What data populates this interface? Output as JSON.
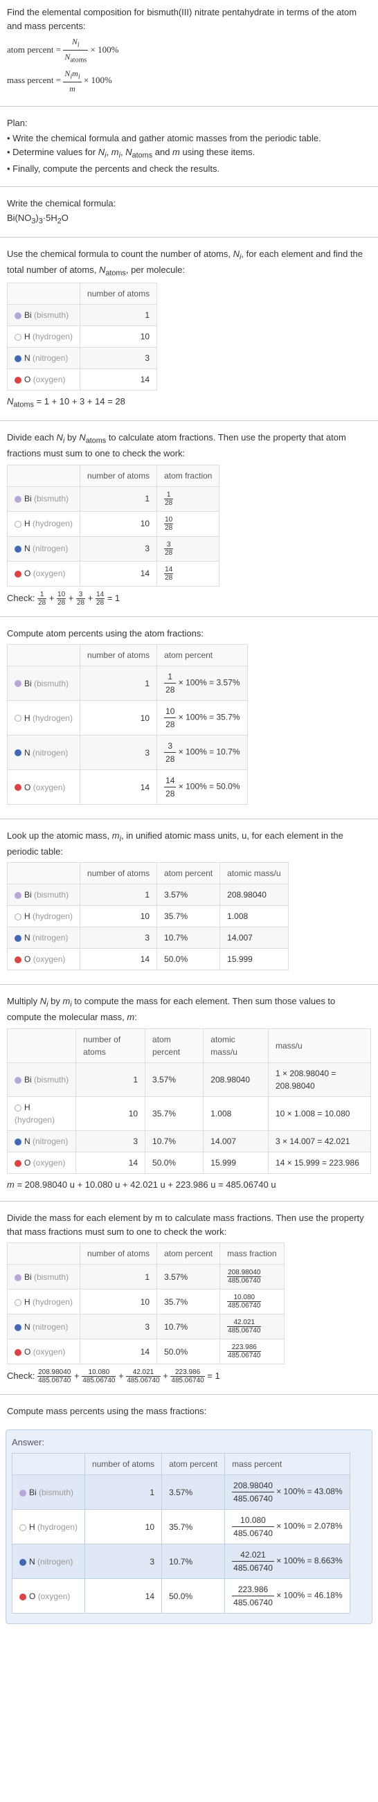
{
  "intro": {
    "line1": "Find the elemental composition for bismuth(III) nitrate pentahydrate in terms of the atom and mass percents:",
    "atom_percent_label": "atom percent",
    "mass_percent_label": "mass percent",
    "eq": "=",
    "times100": "× 100%",
    "Ni": "N",
    "i": "i",
    "Natoms": "N",
    "atoms": "atoms",
    "mi_N": "N",
    "mi_i": "i",
    "mi_m_i": "m",
    "mi_m": "m"
  },
  "plan": {
    "title": "Plan:",
    "items": [
      "• Write the chemical formula and gather atomic masses from the periodic table.",
      "• Determine values for Nᵢ, mᵢ, N_atoms and m using these items.",
      "• Finally, compute the percents and check the results."
    ]
  },
  "formula_section": {
    "title": "Write the chemical formula:",
    "formula_pre": "Bi(NO",
    "s3": "3",
    "close": ")",
    "s3b": "3",
    "dot": "·5H",
    "s2": "2",
    "O": "O"
  },
  "count_section": {
    "text": "Use the chemical formula to count the number of atoms, Nᵢ, for each element and find the total number of atoms, N_atoms, per molecule:",
    "headers": [
      "",
      "number of atoms"
    ],
    "rows": [
      {
        "el": "Bi",
        "name": "(bismuth)",
        "n": "1"
      },
      {
        "el": "H",
        "name": "(hydrogen)",
        "n": "10"
      },
      {
        "el": "N",
        "name": "(nitrogen)",
        "n": "3"
      },
      {
        "el": "O",
        "name": "(oxygen)",
        "n": "14"
      }
    ],
    "total_line": "N_atoms = 1 + 10 + 3 + 14 = 28"
  },
  "atomfrac_section": {
    "text": "Divide each Nᵢ by N_atoms to calculate atom fractions. Then use the property that atom fractions must sum to one to check the work:",
    "headers": [
      "",
      "number of atoms",
      "atom fraction"
    ],
    "rows": [
      {
        "el": "Bi",
        "name": "(bismuth)",
        "n": "1",
        "fn": "1",
        "fd": "28"
      },
      {
        "el": "H",
        "name": "(hydrogen)",
        "n": "10",
        "fn": "10",
        "fd": "28"
      },
      {
        "el": "N",
        "name": "(nitrogen)",
        "n": "3",
        "fn": "3",
        "fd": "28"
      },
      {
        "el": "O",
        "name": "(oxygen)",
        "n": "14",
        "fn": "14",
        "fd": "28"
      }
    ],
    "check_label": "Check:",
    "check_expr": " = 1"
  },
  "atompct_section": {
    "text": "Compute atom percents using the atom fractions:",
    "headers": [
      "",
      "number of atoms",
      "atom percent"
    ],
    "rows": [
      {
        "el": "Bi",
        "name": "(bismuth)",
        "n": "1",
        "fn": "1",
        "fd": "28",
        "pct": " × 100% = 3.57%"
      },
      {
        "el": "H",
        "name": "(hydrogen)",
        "n": "10",
        "fn": "10",
        "fd": "28",
        "pct": " × 100% = 35.7%"
      },
      {
        "el": "N",
        "name": "(nitrogen)",
        "n": "3",
        "fn": "3",
        "fd": "28",
        "pct": " × 100% = 10.7%"
      },
      {
        "el": "O",
        "name": "(oxygen)",
        "n": "14",
        "fn": "14",
        "fd": "28",
        "pct": " × 100% = 50.0%"
      }
    ]
  },
  "atomicmass_section": {
    "text": "Look up the atomic mass, mᵢ, in unified atomic mass units, u, for each element in the periodic table:",
    "headers": [
      "",
      "number of atoms",
      "atom percent",
      "atomic mass/u"
    ],
    "rows": [
      {
        "el": "Bi",
        "name": "(bismuth)",
        "n": "1",
        "pct": "3.57%",
        "mass": "208.98040"
      },
      {
        "el": "H",
        "name": "(hydrogen)",
        "n": "10",
        "pct": "35.7%",
        "mass": "1.008"
      },
      {
        "el": "N",
        "name": "(nitrogen)",
        "n": "3",
        "pct": "10.7%",
        "mass": "14.007"
      },
      {
        "el": "O",
        "name": "(oxygen)",
        "n": "14",
        "pct": "50.0%",
        "mass": "15.999"
      }
    ]
  },
  "molarmass_section": {
    "text": "Multiply Nᵢ by mᵢ to compute the mass for each element. Then sum those values to compute the molecular mass, m:",
    "headers": [
      "",
      "number of atoms",
      "atom percent",
      "atomic mass/u",
      "mass/u"
    ],
    "rows": [
      {
        "el": "Bi",
        "name": "(bismuth)",
        "n": "1",
        "pct": "3.57%",
        "amass": "208.98040",
        "calc": "1 × 208.98040 = 208.98040"
      },
      {
        "el": "H",
        "name": "(hydrogen)",
        "n": "10",
        "pct": "35.7%",
        "amass": "1.008",
        "calc": "10 × 1.008 = 10.080"
      },
      {
        "el": "N",
        "name": "(nitrogen)",
        "n": "3",
        "pct": "10.7%",
        "amass": "14.007",
        "calc": "3 × 14.007 = 42.021"
      },
      {
        "el": "O",
        "name": "(oxygen)",
        "n": "14",
        "pct": "50.0%",
        "amass": "15.999",
        "calc": "14 × 15.999 = 223.986"
      }
    ],
    "total_line": "m = 208.98040 u + 10.080 u + 42.021 u + 223.986 u = 485.06740 u"
  },
  "massfrac_section": {
    "text": "Divide the mass for each element by m to calculate mass fractions. Then use the property that mass fractions must sum to one to check the work:",
    "headers": [
      "",
      "number of atoms",
      "atom percent",
      "mass fraction"
    ],
    "rows": [
      {
        "el": "Bi",
        "name": "(bismuth)",
        "n": "1",
        "pct": "3.57%",
        "fn": "208.98040",
        "fd": "485.06740"
      },
      {
        "el": "H",
        "name": "(hydrogen)",
        "n": "10",
        "pct": "35.7%",
        "fn": "10.080",
        "fd": "485.06740"
      },
      {
        "el": "N",
        "name": "(nitrogen)",
        "n": "3",
        "pct": "10.7%",
        "fn": "42.021",
        "fd": "485.06740"
      },
      {
        "el": "O",
        "name": "(oxygen)",
        "n": "14",
        "pct": "50.0%",
        "fn": "223.986",
        "fd": "485.06740"
      }
    ],
    "check_label": "Check:",
    "check_end": " = 1"
  },
  "masspct_intro": "Compute mass percents using the mass fractions:",
  "answer": {
    "title": "Answer:",
    "headers": [
      "",
      "number of atoms",
      "atom percent",
      "mass percent"
    ],
    "rows": [
      {
        "el": "Bi",
        "name": "(bismuth)",
        "n": "1",
        "pct": "3.57%",
        "fn": "208.98040",
        "fd": "485.06740",
        "end": " × 100% = 43.08%"
      },
      {
        "el": "H",
        "name": "(hydrogen)",
        "n": "10",
        "pct": "35.7%",
        "fn": "10.080",
        "fd": "485.06740",
        "end": " × 100% = 2.078%"
      },
      {
        "el": "N",
        "name": "(nitrogen)",
        "n": "3",
        "pct": "10.7%",
        "fn": "42.021",
        "fd": "485.06740",
        "end": " × 100% = 8.663%"
      },
      {
        "el": "O",
        "name": "(oxygen)",
        "n": "14",
        "pct": "50.0%",
        "fn": "223.986",
        "fd": "485.06740",
        "end": " × 100% = 46.18%"
      }
    ]
  },
  "dots": {
    "Bi": "dot-bi",
    "H": "dot-h",
    "N": "dot-n",
    "O": "dot-o"
  }
}
